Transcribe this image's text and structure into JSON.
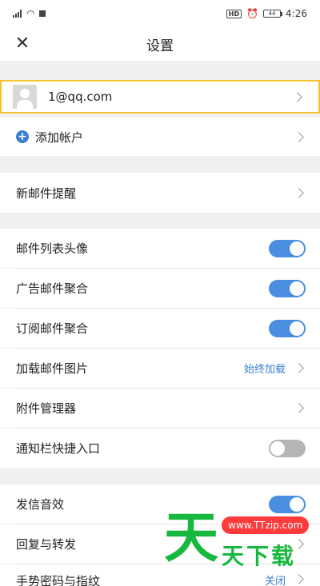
{
  "status_bar": {
    "time": "4:26",
    "battery": "44"
  },
  "header": {
    "title": "设置",
    "close_icon": "close-icon"
  },
  "account": {
    "email": "1@qq.com",
    "add_account": "添加帐户"
  },
  "rows": {
    "new_mail_alert": "新邮件提醒",
    "list_avatar": "邮件列表头像",
    "ad_mail": "广告邮件聚合",
    "subscription_mail": "订阅邮件聚合",
    "load_images": "加载邮件图片",
    "load_images_value": "始终加载",
    "attachment_manager": "附件管理器",
    "notification_shortcut": "通知栏快捷入口",
    "send_sound": "发信音效",
    "reply_forward": "回复与转发",
    "gesture_password": "手势密码与指纹",
    "gesture_password_value": "关闭"
  },
  "toggles": {
    "list_avatar": true,
    "ad_mail": true,
    "subscription_mail": true,
    "notification_shortcut": false,
    "send_sound": true
  },
  "watermark": {
    "url": "www.TTzip.com",
    "big": "天",
    "small": "天下载"
  },
  "colors": {
    "accent": "#4a8ee2",
    "link": "#3a7fd0",
    "highlight": "#f4c430",
    "watermark": "#17b83e"
  }
}
